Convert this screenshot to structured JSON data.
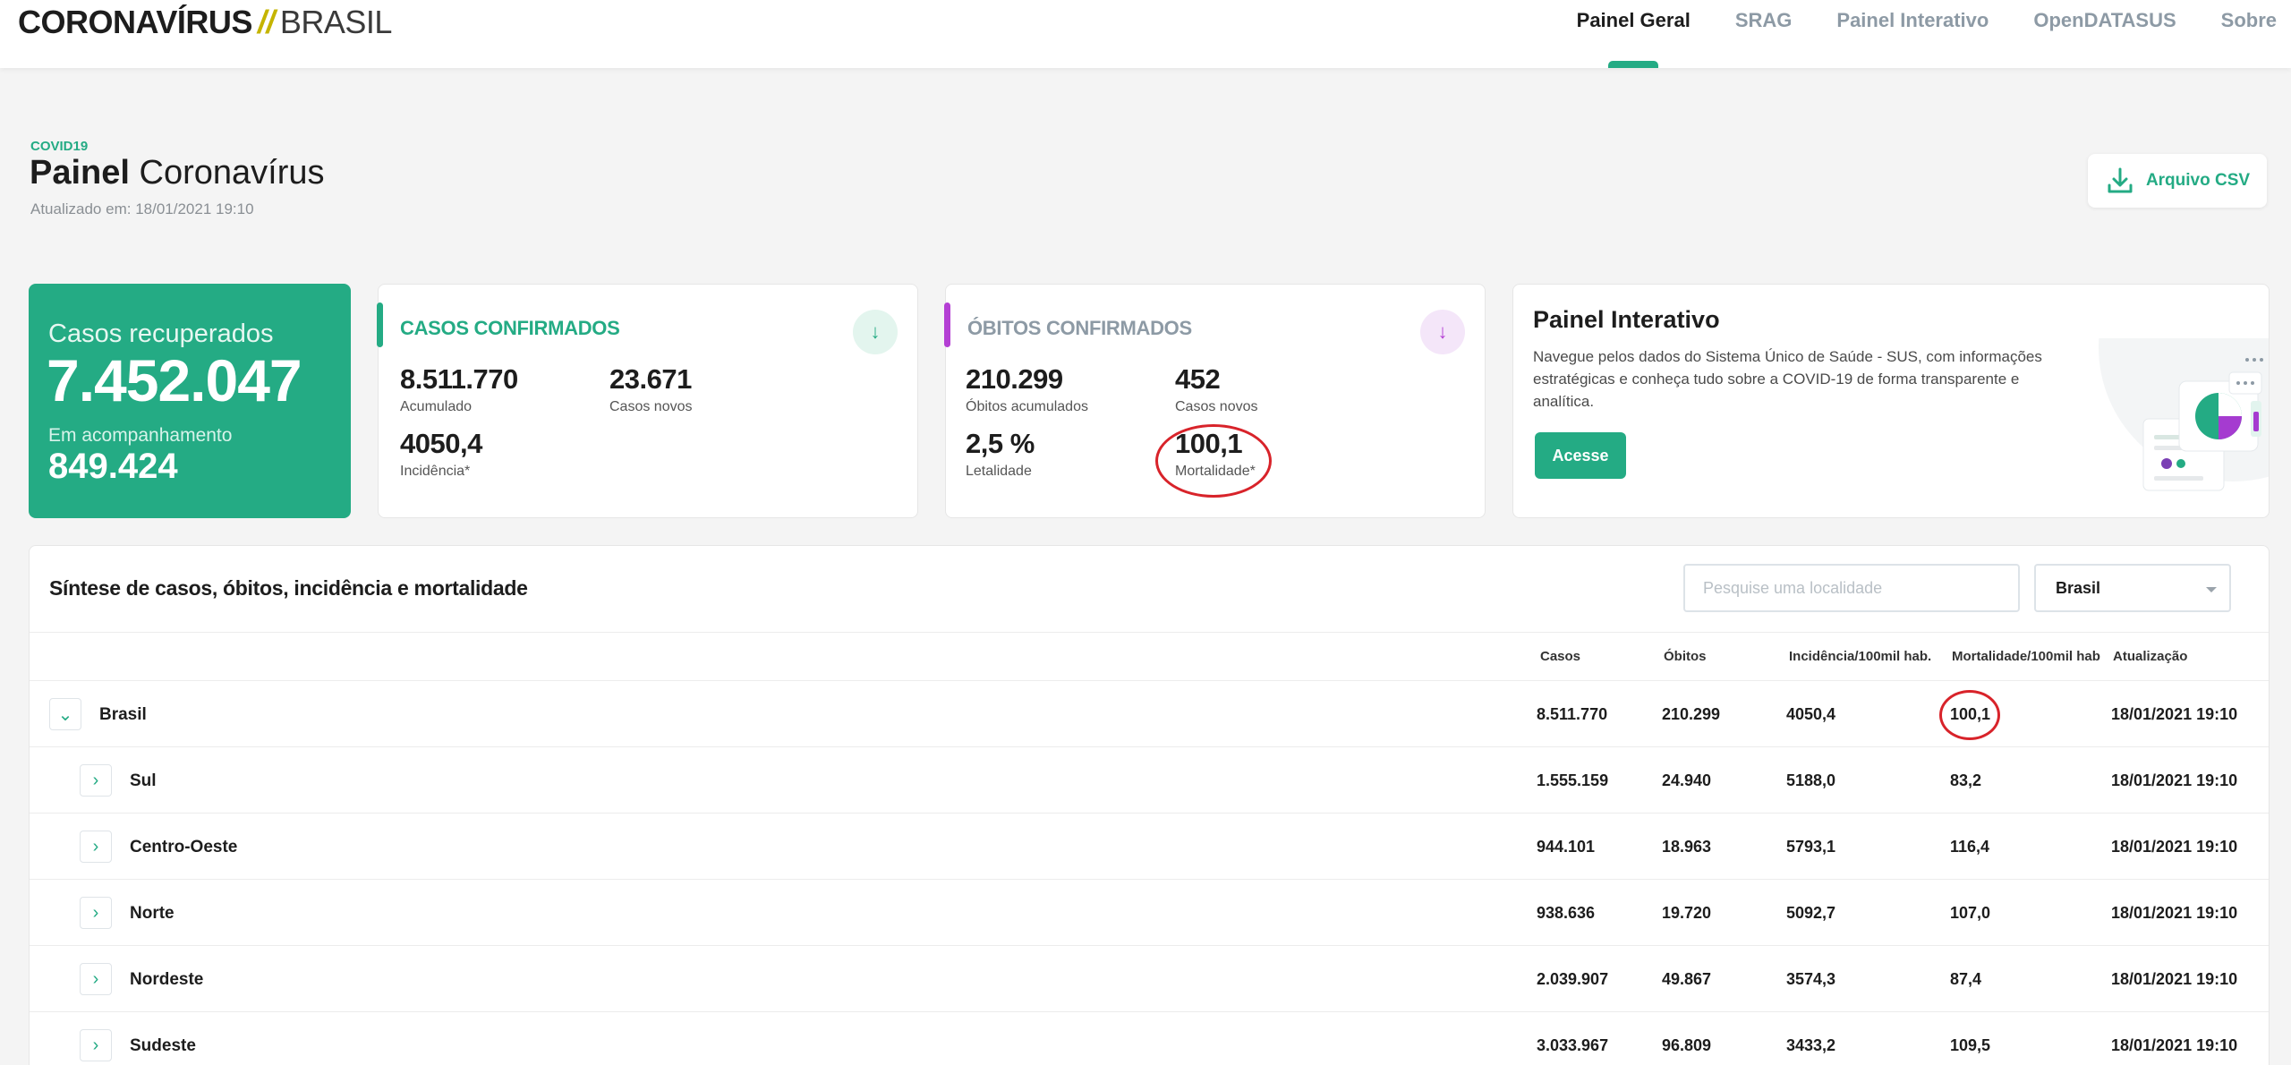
{
  "header": {
    "logo_main": "CORONAVÍRUS",
    "logo_sep": "//",
    "logo_country": "BRASIL",
    "nav": [
      "Painel Geral",
      "SRAG",
      "Painel Interativo",
      "OpenDATASUS",
      "Sobre"
    ],
    "active_nav": "Painel Geral"
  },
  "page": {
    "tag": "COVID19",
    "title_bold": "Painel",
    "title_rest": "Coronavírus",
    "updated_label": "Atualizado em:",
    "updated_value": "18/01/2021 19:10",
    "csv_button": "Arquivo CSV"
  },
  "recovered": {
    "label": "Casos recuperados",
    "value": "7.452.047",
    "sub_label": "Em acompanhamento",
    "sub_value": "849.424"
  },
  "confirmed": {
    "title": "CASOS CONFIRMADOS",
    "accumulated": "8.511.770",
    "accumulated_label": "Acumulado",
    "new_cases": "23.671",
    "new_cases_label": "Casos novos",
    "incidence": "4050,4",
    "incidence_label": "Incidência*"
  },
  "deaths": {
    "title": "ÓBITOS CONFIRMADOS",
    "accumulated": "210.299",
    "accumulated_label": "Óbitos acumulados",
    "new_cases": "452",
    "new_cases_label": "Casos novos",
    "lethality": "2,5 %",
    "lethality_label": "Letalidade",
    "mortality": "100,1",
    "mortality_label": "Mortalidade*"
  },
  "interactive": {
    "title": "Painel Interativo",
    "text": "Navegue pelos dados do Sistema Único de Saúde - SUS, com informações estratégicas e conheça tudo sobre a COVID-19 de forma transparente e analítica.",
    "button": "Acesse"
  },
  "table": {
    "title": "Síntese de casos, óbitos, incidência e mortalidade",
    "search_placeholder": "Pesquise uma localidade",
    "select_value": "Brasil",
    "headers": [
      "Casos",
      "Óbitos",
      "Incidência/100mil hab.",
      "Mortalidade/100mil hab",
      "Atualização"
    ],
    "rows": [
      {
        "name": "Brasil",
        "cases": "8.511.770",
        "deaths": "210.299",
        "incidence": "4050,4",
        "mortality": "100,1",
        "updated": "18/01/2021 19:10"
      },
      {
        "name": "Sul",
        "cases": "1.555.159",
        "deaths": "24.940",
        "incidence": "5188,0",
        "mortality": "83,2",
        "updated": "18/01/2021 19:10"
      },
      {
        "name": "Centro-Oeste",
        "cases": "944.101",
        "deaths": "18.963",
        "incidence": "5793,1",
        "mortality": "116,4",
        "updated": "18/01/2021 19:10"
      },
      {
        "name": "Norte",
        "cases": "938.636",
        "deaths": "19.720",
        "incidence": "5092,7",
        "mortality": "107,0",
        "updated": "18/01/2021 19:10"
      },
      {
        "name": "Nordeste",
        "cases": "2.039.907",
        "deaths": "49.867",
        "incidence": "3574,3",
        "mortality": "87,4",
        "updated": "18/01/2021 19:10"
      },
      {
        "name": "Sudeste",
        "cases": "3.033.967",
        "deaths": "96.809",
        "incidence": "3433,2",
        "mortality": "109,5",
        "updated": "18/01/2021 19:10"
      }
    ]
  },
  "colors": {
    "brand_green": "#24ab84",
    "purple_accent": "#b43fd4",
    "highlight_ring": "#d8232a"
  }
}
